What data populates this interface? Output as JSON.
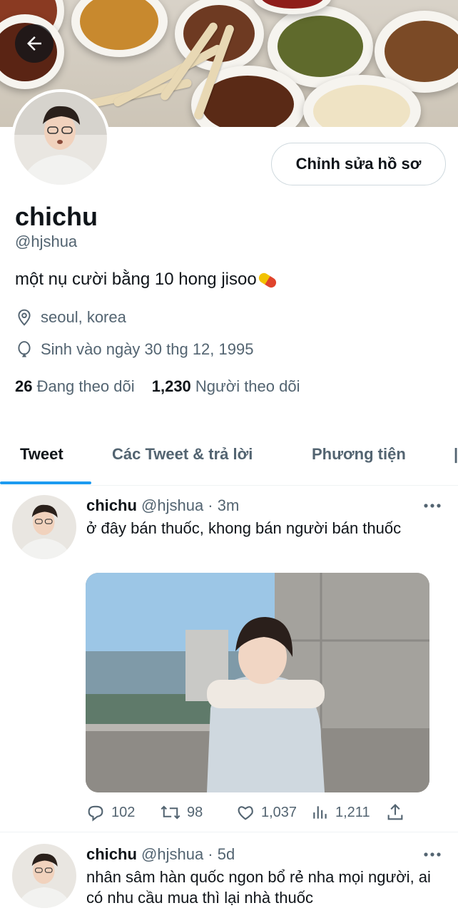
{
  "profile": {
    "edit_label": "Chỉnh sửa hồ sơ",
    "display_name": "chichu",
    "handle": "@hjshua",
    "bio": "một nụ cười bằng 10 hong jisoo",
    "location": "seoul, korea",
    "birthday": "Sinh vào ngày 30 thg 12, 1995",
    "following_count": "26",
    "following_label": "Đang theo dõi",
    "followers_count": "1,230",
    "followers_label": "Người theo dõi"
  },
  "tabs": [
    {
      "label": "Tweet",
      "active": true
    },
    {
      "label": "Các Tweet & trả lời",
      "active": false
    },
    {
      "label": "Phương tiện",
      "active": false
    }
  ],
  "tweets": [
    {
      "name": "chichu",
      "handle_time": "@hjshua · 3m",
      "text": "ở đây bán thuốc, khong bán người bán thuốc",
      "replies": "102",
      "retweets": "98",
      "likes": "1,037",
      "views": "1,211"
    },
    {
      "name": "chichu",
      "handle_time": "@hjshua · 5d",
      "text": "nhân sâm hàn quốc ngon bổ rẻ nha mọi người, ai có nhu cầu mua thì lại nhà thuốc"
    }
  ],
  "icons": {
    "back": "arrow-left-icon",
    "location": "location-pin-icon",
    "birthday": "balloon-icon",
    "more": "more-dots-icon",
    "reply": "reply-icon",
    "retweet": "retweet-icon",
    "like": "heart-icon",
    "views": "views-icon",
    "share": "share-icon"
  },
  "colors": {
    "accent": "#1d9bf0",
    "text_primary": "#0f1419",
    "text_secondary": "#536471",
    "border": "#cfd9de"
  }
}
